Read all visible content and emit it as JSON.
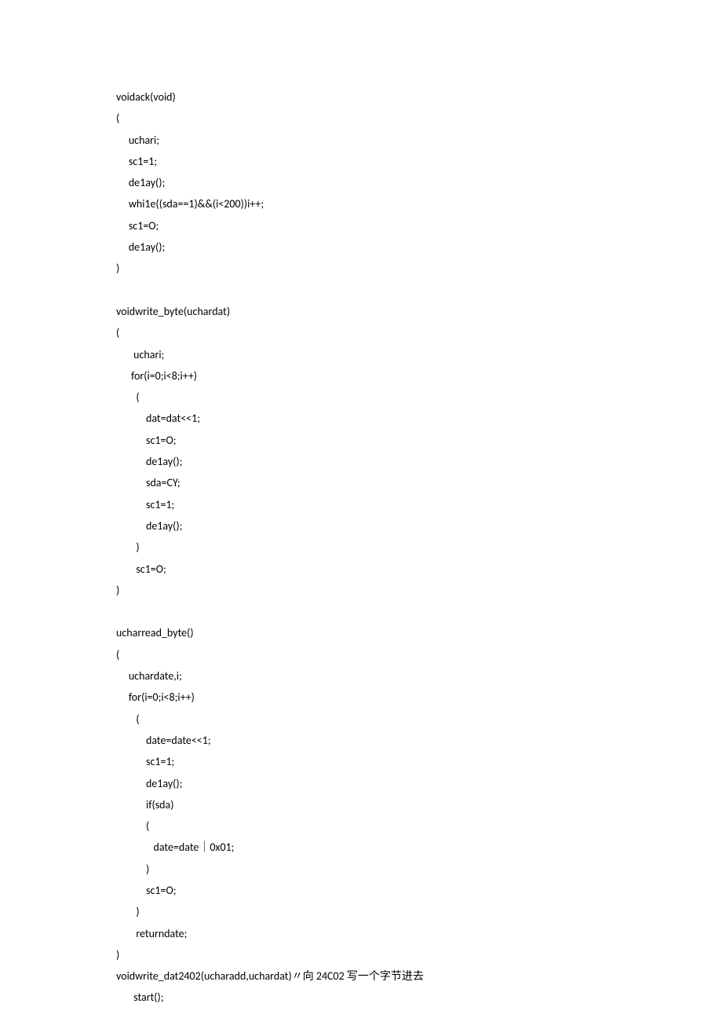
{
  "lines": [
    "voidack(void)",
    "(",
    "     uchari;",
    "     sc1=1;",
    "     de1ay();",
    "     whi1e((sda==1)&&(i<200))i++;",
    "     sc1=O;",
    "     de1ay();",
    ")",
    "",
    "voidwrite_byte(uchardat)",
    "(",
    "       uchari;",
    "      for(i=0;i<8;i++)",
    "        (",
    "            dat=dat<<1;",
    "            sc1=O;",
    "            de1ay();",
    "            sda=CY;",
    "            sc1=1;",
    "            de1ay();",
    "        )",
    "        sc1=O;",
    ")",
    "",
    "ucharread_byte()",
    "(",
    "     uchardate,i;",
    "     for(i=0;i<8;i++)",
    "        (",
    "            date=date<<1;",
    "            sc1=1;",
    "            de1ay();",
    "            if(sda)",
    "            (",
    "               date=date｜0x01;",
    "            )",
    "            sc1=O;",
    "        )",
    "        returndate;",
    ")",
    "voidwrite_dat2402(ucharadd,uchardat)〃向 24C02 写一个字节进去",
    "       start();"
  ]
}
